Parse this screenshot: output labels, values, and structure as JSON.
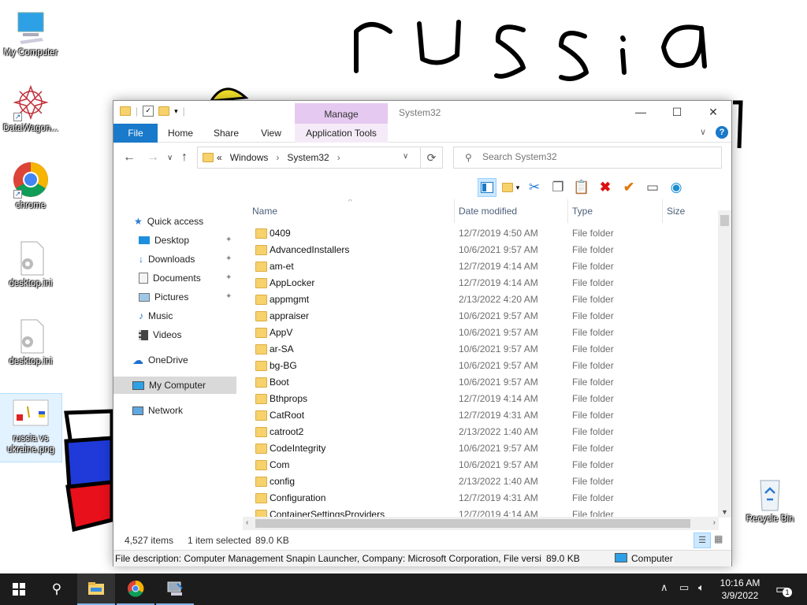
{
  "desktop": {
    "drawing_text": "russia",
    "icons": [
      {
        "label": "My Computer"
      },
      {
        "label": "DataWagon..."
      },
      {
        "label": "chrome"
      },
      {
        "label": "desktop.ini"
      },
      {
        "label": "desktop.ini"
      },
      {
        "label": "russia vs ukraine.png"
      },
      {
        "label": "Recycle Bin"
      }
    ]
  },
  "window": {
    "title": "System32",
    "manage_tab": "Manage",
    "ribbon_tabs": {
      "file": "File",
      "home": "Home",
      "share": "Share",
      "view": "View",
      "app_tools": "Application Tools"
    },
    "controls": {
      "minimize": "—",
      "maximize": "☐",
      "close": "✕"
    },
    "address": {
      "prefix": "«",
      "crumbs": [
        "Windows",
        "System32"
      ]
    },
    "search": {
      "placeholder": "Search System32"
    },
    "nav": [
      {
        "label": "Quick access",
        "icon": "star-icon"
      },
      {
        "label": "Desktop",
        "icon": "desktop-icon",
        "pinned": true
      },
      {
        "label": "Downloads",
        "icon": "download-icon",
        "pinned": true
      },
      {
        "label": "Documents",
        "icon": "documents-icon",
        "pinned": true
      },
      {
        "label": "Pictures",
        "icon": "pictures-icon",
        "pinned": true
      },
      {
        "label": "Music",
        "icon": "music-icon"
      },
      {
        "label": "Videos",
        "icon": "videos-icon"
      },
      {
        "label": "OneDrive",
        "icon": "cloud-icon"
      },
      {
        "label": "My Computer",
        "icon": "computer-icon",
        "selected": true
      },
      {
        "label": "Network",
        "icon": "network-icon"
      }
    ],
    "columns": {
      "name": "Name",
      "date": "Date modified",
      "type": "Type",
      "size": "Size"
    },
    "files": [
      {
        "name": "0409",
        "date": "12/7/2019 4:50 AM",
        "type": "File folder"
      },
      {
        "name": "AdvancedInstallers",
        "date": "10/6/2021 9:57 AM",
        "type": "File folder"
      },
      {
        "name": "am-et",
        "date": "12/7/2019 4:14 AM",
        "type": "File folder"
      },
      {
        "name": "AppLocker",
        "date": "12/7/2019 4:14 AM",
        "type": "File folder"
      },
      {
        "name": "appmgmt",
        "date": "2/13/2022 4:20 AM",
        "type": "File folder"
      },
      {
        "name": "appraiser",
        "date": "10/6/2021 9:57 AM",
        "type": "File folder"
      },
      {
        "name": "AppV",
        "date": "10/6/2021 9:57 AM",
        "type": "File folder"
      },
      {
        "name": "ar-SA",
        "date": "10/6/2021 9:57 AM",
        "type": "File folder"
      },
      {
        "name": "bg-BG",
        "date": "10/6/2021 9:57 AM",
        "type": "File folder"
      },
      {
        "name": "Boot",
        "date": "10/6/2021 9:57 AM",
        "type": "File folder"
      },
      {
        "name": "Bthprops",
        "date": "12/7/2019 4:14 AM",
        "type": "File folder"
      },
      {
        "name": "CatRoot",
        "date": "12/7/2019 4:31 AM",
        "type": "File folder"
      },
      {
        "name": "catroot2",
        "date": "2/13/2022 1:40 AM",
        "type": "File folder"
      },
      {
        "name": "CodeIntegrity",
        "date": "10/6/2021 9:57 AM",
        "type": "File folder"
      },
      {
        "name": "Com",
        "date": "10/6/2021 9:57 AM",
        "type": "File folder"
      },
      {
        "name": "config",
        "date": "2/13/2022 1:40 AM",
        "type": "File folder"
      },
      {
        "name": "Configuration",
        "date": "12/7/2019 4:31 AM",
        "type": "File folder"
      },
      {
        "name": "ContainerSettingsProviders",
        "date": "12/7/2019 4:14 AM",
        "type": "File folder"
      }
    ],
    "status": {
      "items": "4,527 items",
      "selected": "1 item selected",
      "size": "89.0 KB"
    },
    "description": {
      "text": "File description: Computer Management Snapin Launcher, Company: Microsoft Corporation, File versi",
      "size": "89.0 KB",
      "location": "Computer"
    }
  },
  "taskbar": {
    "time": "10:16 AM",
    "date": "3/9/2022",
    "notification_count": "1"
  },
  "colors": {
    "file_tab": "#1979ca",
    "manage_tab": "#e5c9f0",
    "taskbar": "#1c1c1c",
    "selection": "#cce8ff"
  }
}
